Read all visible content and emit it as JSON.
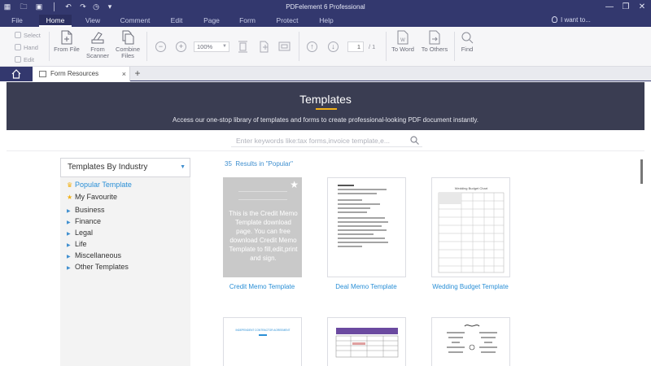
{
  "titlebar": {
    "title": "PDFelement 6 Professional",
    "quick_access": [
      "app-icon",
      "open-icon",
      "save-icon",
      "undo-icon",
      "redo-icon",
      "history-icon",
      "dropdown-icon"
    ],
    "window_buttons": [
      "minimize-icon",
      "restore-icon",
      "close-icon"
    ]
  },
  "menu": {
    "items": [
      "File",
      "Home",
      "View",
      "Comment",
      "Edit",
      "Page",
      "Form",
      "Protect",
      "Help"
    ],
    "active": "Home",
    "iwant": "I want to..."
  },
  "toolbar": {
    "select": "Select",
    "hand": "Hand",
    "edit": "Edit",
    "from_file": "From File",
    "from_scanner_1": "From",
    "from_scanner_2": "Scanner",
    "combine_1": "Combine",
    "combine_2": "Files",
    "zoom": "100%",
    "page_current": "1",
    "page_total": "/ 1",
    "to_word": "To Word",
    "to_others": "To Others",
    "find": "Find"
  },
  "tabs": {
    "doc_tab": "Form Resources",
    "close": "×",
    "new": "+"
  },
  "banner": {
    "title": "Templates",
    "subtitle": "Access our one-stop library of templates and forms to create professional-looking PDF document instantly."
  },
  "search": {
    "placeholder": "Enter keywords like:tax forms,invoice template,e..."
  },
  "sidebar": {
    "select_label": "Templates By Industry",
    "popular": "Popular Template",
    "favourite": "My Favourite",
    "items": [
      "Business",
      "Finance",
      "Legal",
      "Life",
      "Miscellaneous",
      "Other Templates"
    ]
  },
  "results": {
    "count": "35",
    "label": "Results in \"Popular\"",
    "hover_text": "This is the Credit Memo Template download page. You can free download Credit Memo Template to fill,edit,print and sign.",
    "cards": [
      {
        "label": "Credit Memo Template"
      },
      {
        "label": "Deal Memo Template"
      },
      {
        "label": "Wedding Budget Template"
      }
    ],
    "wedding_preview_title": "Wedding Budget Chart",
    "row2_preview_title": "INDEPENDENT CONTRACTOR AGREEMENT"
  },
  "colors": {
    "titlebar": "#33386e",
    "banner": "#3a3d52",
    "accent": "#2a8fd6",
    "underline": "#f2b118"
  }
}
